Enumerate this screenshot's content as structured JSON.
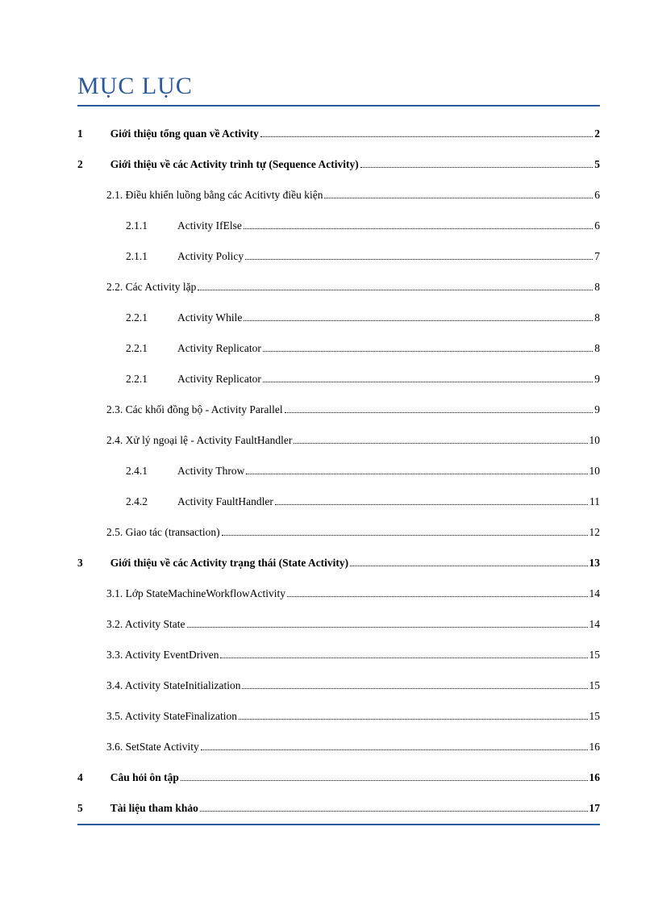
{
  "title": "MỤC LỤC",
  "entries": [
    {
      "level": 0,
      "bold": true,
      "num": "1",
      "text": "Giới thiệu tổng quan về Activity",
      "page": "2",
      "gapAfterNum": true,
      "trailSpace": true
    },
    {
      "level": 0,
      "bold": true,
      "num": "2",
      "text": "Giới thiệu về các Activity trình tự (Sequence Activity)",
      "page": "5",
      "gapAfterNum": true,
      "trailSpace": true
    },
    {
      "level": 1,
      "bold": false,
      "num": "",
      "text": "2.1. Điều khiển luồng bằng các Acitivty điều kiện",
      "page": "6"
    },
    {
      "level": 2,
      "bold": false,
      "num": "2.1.1",
      "text": "Activity IfElse",
      "page": "6"
    },
    {
      "level": 2,
      "bold": false,
      "num": "2.1.1",
      "text": "Activity Policy",
      "page": "7"
    },
    {
      "level": 1,
      "bold": false,
      "num": "",
      "text": "2.2. Các Activity lặp",
      "page": "8"
    },
    {
      "level": 2,
      "bold": false,
      "num": "2.2.1",
      "text": "Activity While",
      "page": "8"
    },
    {
      "level": 2,
      "bold": false,
      "num": "2.2.1",
      "text": "Activity Replicator",
      "page": "8"
    },
    {
      "level": 2,
      "bold": false,
      "num": "2.2.1",
      "text": "Activity Replicator",
      "page": "9"
    },
    {
      "level": 1,
      "bold": false,
      "num": "",
      "text": "2.3. Các khối đồng bộ - Activity Parallel",
      "page": "9"
    },
    {
      "level": 1,
      "bold": false,
      "num": "",
      "text": "2.4. Xử lý ngoại lệ - Activity FaultHandler",
      "page": "10"
    },
    {
      "level": 2,
      "bold": false,
      "num": "2.4.1",
      "text": "Activity Throw",
      "page": "10"
    },
    {
      "level": 2,
      "bold": false,
      "num": "2.4.2",
      "text": "Activity FaultHandler",
      "page": "11"
    },
    {
      "level": 1,
      "bold": false,
      "num": "",
      "text": "2.5. Giao tác (transaction)",
      "page": "12"
    },
    {
      "level": 0,
      "bold": true,
      "num": "3",
      "text": "Giới thiệu về các Activity trạng thái (State Activity)",
      "page": "13",
      "gapAfterNum": true
    },
    {
      "level": 1,
      "bold": false,
      "num": "",
      "text": "3.1. Lớp StateMachineWorkflowActivity",
      "page": "14"
    },
    {
      "level": 1,
      "bold": false,
      "num": "",
      "text": "3.2. Activity State",
      "page": "14"
    },
    {
      "level": 1,
      "bold": false,
      "num": "",
      "text": "3.3. Activity EventDriven",
      "page": "15"
    },
    {
      "level": 1,
      "bold": false,
      "num": "",
      "text": "3.4. Activity StateInitialization",
      "page": "15"
    },
    {
      "level": 1,
      "bold": false,
      "num": "",
      "text": "3.5. Activity StateFinalization",
      "page": "15"
    },
    {
      "level": 1,
      "bold": false,
      "num": "",
      "text": "3.6. SetState Activity",
      "page": "16"
    },
    {
      "level": 0,
      "bold": true,
      "num": "4",
      "text": "Câu hỏi ôn tập",
      "page": "16",
      "gapAfterNum": true
    },
    {
      "level": 0,
      "bold": true,
      "num": "5",
      "text": "Tài liệu tham khảo",
      "page": "17",
      "gapAfterNum": true
    }
  ]
}
